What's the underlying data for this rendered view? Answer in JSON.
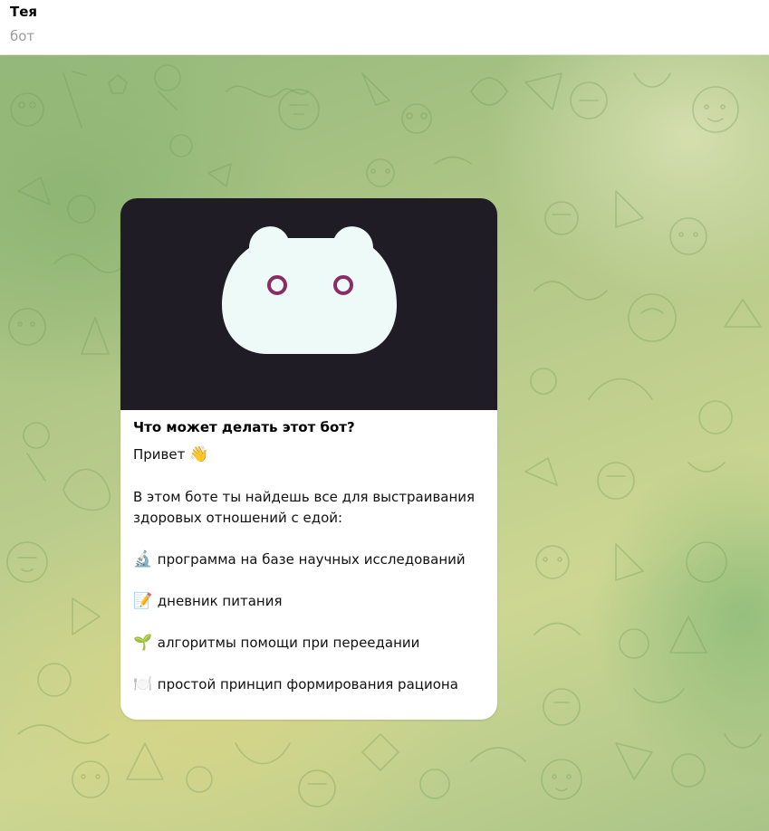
{
  "header": {
    "title": "Тея",
    "subtitle": "бот"
  },
  "colors": {
    "banner_background": "#201c25",
    "mascot_body": "#eefaf8",
    "mascot_eye_ring": "#8a2d66",
    "pattern_stroke": "#6f9a5a"
  },
  "bot_card": {
    "banner_image": "bot-mascot-cat",
    "heading": "Что может делать этот бот?",
    "greeting": {
      "text": "Привет",
      "emoji": "👋"
    },
    "intro_line1": "В этом боте ты найдешь все для выстраивания",
    "intro_line2": "здоровых отношений с едой:",
    "features": [
      {
        "icon": "microscope-icon",
        "emoji": "🔬",
        "text": "программа на базе научных исследований"
      },
      {
        "icon": "memo-icon",
        "emoji": "📝",
        "text": "дневник питания"
      },
      {
        "icon": "seedling-icon",
        "emoji": "🌱",
        "text": "алгоритмы помощи при переедании"
      },
      {
        "icon": "plate-icon",
        "emoji": "🍽️",
        "text": "простой принцип формирования рациона"
      }
    ]
  }
}
